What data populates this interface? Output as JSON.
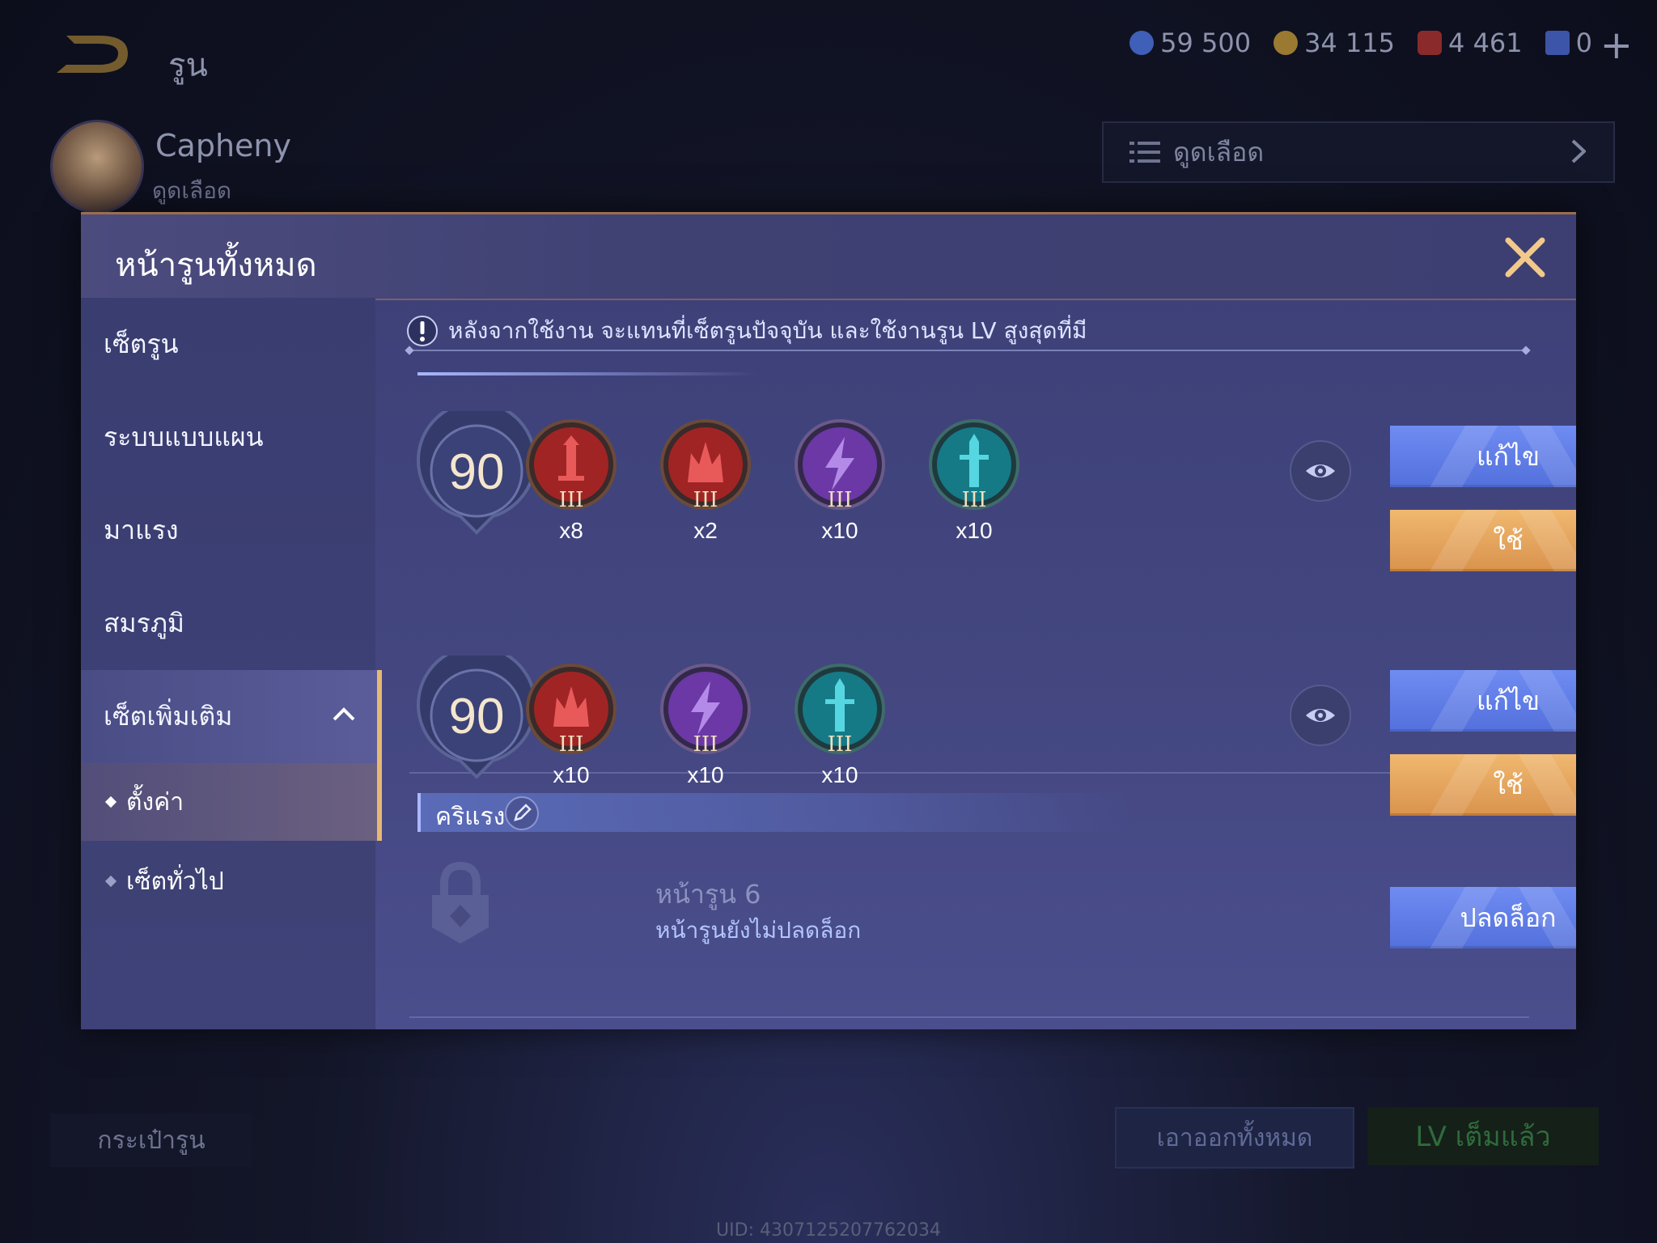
{
  "background": {
    "page_title": "รูน",
    "currencies": [
      {
        "icon": "diamond-currency-icon",
        "value": "59 500",
        "color": "#5a7bd8"
      },
      {
        "icon": "gold-coin-icon",
        "value": "34 115",
        "color": "#c9a24a"
      },
      {
        "icon": "ruby-gem-icon",
        "value": "4 461",
        "color": "#b43a3a"
      },
      {
        "icon": "rune-ticket-icon",
        "value": "0",
        "color": "#4a6ad0"
      }
    ],
    "hero_name": "Capheny",
    "hero_sub": "ดูดเลือด",
    "set_select_label": "ดูดเลือด",
    "bag_button": "กระเป๋ารูน",
    "remove_all_button": "เอาออกทั้งหมด",
    "lv_max_button": "LV เต็มแล้ว",
    "uid": "UID: 4307125207762034"
  },
  "modal": {
    "title": "หน้ารูนทั้งหมด",
    "sidebar": {
      "items": [
        {
          "label": "เซ็ตรูน"
        },
        {
          "label": "ระบบแบบแผน"
        },
        {
          "label": "มาแรง"
        },
        {
          "label": "สมรภูมิ"
        },
        {
          "label": "เซ็ตเพิ่มเติม"
        }
      ],
      "sub_items": [
        {
          "label": "ตั้งค่า"
        },
        {
          "label": "เซ็ตทั่วไป"
        }
      ]
    },
    "notice": "หลังจากใช้งาน จะแทนที่เซ็ตรูนปัจจุบัน และใช้งานรูน LV สูงสุดที่มี",
    "sets": [
      {
        "name": "",
        "level": "90",
        "runes": [
          {
            "icon": "red-sword-rune-icon",
            "tier": "III",
            "qty": "x8",
            "color": "#b82a2a"
          },
          {
            "icon": "red-crown-rune-icon",
            "tier": "III",
            "qty": "x2",
            "color": "#b82a2a"
          },
          {
            "icon": "purple-lightning-rune-icon",
            "tier": "III",
            "qty": "x10",
            "color": "#7a3fb0"
          },
          {
            "icon": "teal-sword-rune-icon",
            "tier": "III",
            "qty": "x10",
            "color": "#1a8f9a"
          }
        ],
        "edit_label": "แก้ไข",
        "use_label": "ใช้"
      },
      {
        "name": "คริแรง",
        "level": "90",
        "runes": [
          {
            "icon": "red-crown-rune-icon",
            "tier": "III",
            "qty": "x10",
            "color": "#b82a2a"
          },
          {
            "icon": "purple-lightning-rune-icon",
            "tier": "III",
            "qty": "x10",
            "color": "#7a3fb0"
          },
          {
            "icon": "teal-sword-rune-icon",
            "tier": "III",
            "qty": "x10",
            "color": "#1a8f9a"
          }
        ],
        "edit_label": "แก้ไข",
        "use_label": "ใช้"
      }
    ],
    "locked_slot": {
      "title": "หน้ารูน 6",
      "subtitle": "หน้ารูนยังไม่ปลดล็อก",
      "unlock_label": "ปลดล็อก"
    }
  }
}
